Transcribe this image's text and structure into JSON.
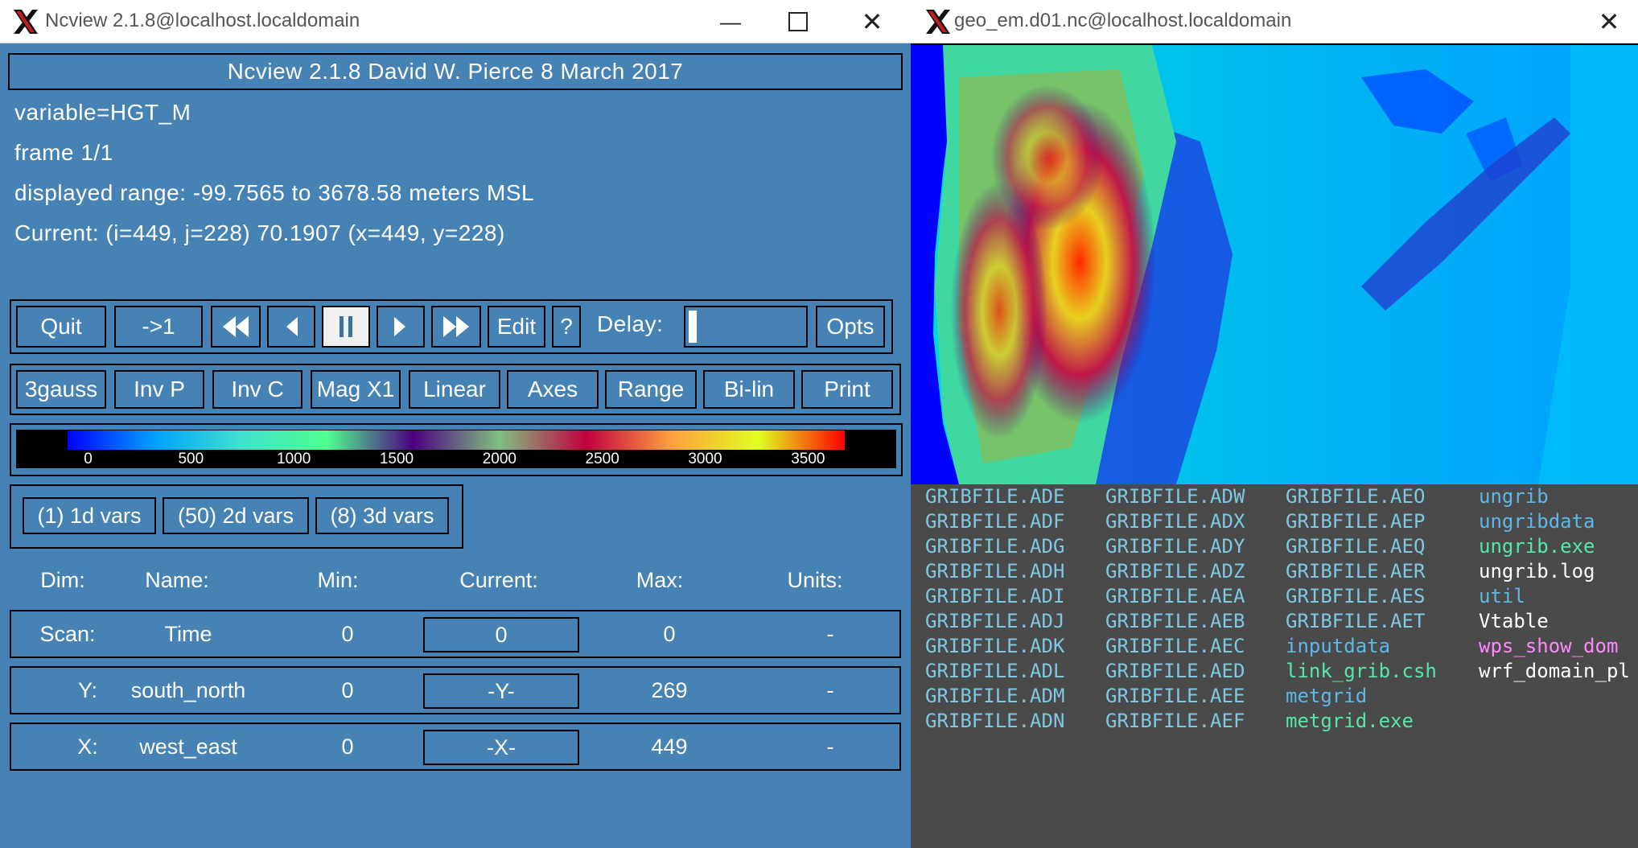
{
  "ncview": {
    "window_title": "Ncview 2.1.8@localhost.localdomain",
    "banner": "Ncview 2.1.8 David W. Pierce  8 March 2017",
    "info": {
      "variable": "variable=HGT_M",
      "frame": "frame 1/1",
      "range": "displayed range: -99.7565 to 3678.58 meters MSL",
      "current": "Current: (i=449, j=228) 70.1907 (x=449, y=228)"
    },
    "controls": {
      "quit": "Quit",
      "to_first": "->1",
      "edit": "Edit",
      "help": "?",
      "delay_label": "Delay:",
      "opts": "Opts"
    },
    "options": {
      "gauss": "3gauss",
      "inv_p": "Inv P",
      "inv_c": "Inv C",
      "mag": "Mag X1",
      "linear": "Linear",
      "axes": "Axes",
      "range": "Range",
      "bilin": "Bi-lin",
      "print": "Print"
    },
    "colorbar_ticks": [
      "0",
      "500",
      "1000",
      "1500",
      "2000",
      "2500",
      "3000",
      "3500"
    ],
    "var_groups": {
      "d1": "(1) 1d vars",
      "d2": "(50) 2d vars",
      "d3": "(8) 3d vars"
    },
    "dim_headers": {
      "dim": "Dim:",
      "name": "Name:",
      "min": "Min:",
      "current": "Current:",
      "max": "Max:",
      "units": "Units:"
    },
    "dims": [
      {
        "dim": "Scan:",
        "name": "Time",
        "min": "0",
        "current": "0",
        "max": "0",
        "units": "-"
      },
      {
        "dim": "Y:",
        "name": "south_north",
        "min": "0",
        "current": "-Y-",
        "max": "269",
        "units": "-"
      },
      {
        "dim": "X:",
        "name": "west_east",
        "min": "0",
        "current": "-X-",
        "max": "449",
        "units": "-"
      }
    ],
    "colors": {
      "panel_bg": "#4682b4",
      "colorbar": [
        "#000000",
        "#0000ff",
        "#00a0ff",
        "#40e0d0",
        "#50ff90",
        "#4b0082",
        "#80c080",
        "#c00040",
        "#ffa040",
        "#e0ff20",
        "#ff0000"
      ]
    }
  },
  "geo_window": {
    "window_title": "geo_em.d01.nc@localhost.localdomain"
  },
  "terminal": {
    "columns": [
      [
        "GRIBFILE.ADE",
        "GRIBFILE.ADF",
        "GRIBFILE.ADG",
        "GRIBFILE.ADH",
        "GRIBFILE.ADI",
        "GRIBFILE.ADJ",
        "GRIBFILE.ADK",
        "GRIBFILE.ADL",
        "GRIBFILE.ADM",
        "GRIBFILE.ADN"
      ],
      [
        "GRIBFILE.ADW",
        "GRIBFILE.ADX",
        "GRIBFILE.ADY",
        "GRIBFILE.ADZ",
        "GRIBFILE.AEA",
        "GRIBFILE.AEB",
        "GRIBFILE.AEC",
        "GRIBFILE.AED",
        "GRIBFILE.AEE",
        "GRIBFILE.AEF"
      ],
      [
        "GRIBFILE.AEO",
        "GRIBFILE.AEP",
        "GRIBFILE.AEQ",
        "GRIBFILE.AER",
        "GRIBFILE.AES",
        "GRIBFILE.AET",
        "inputdata",
        "link_grib.csh",
        "metgrid",
        "metgrid.exe"
      ],
      [
        "ungrib",
        "ungribdata",
        "ungrib.exe",
        "ungrib.log",
        "util",
        "Vtable",
        "wps_show_dom",
        "wrf_domain_pl"
      ]
    ],
    "colors": {
      "file": "#7ec8e3",
      "dir": "#5cb8e8",
      "exe": "#55e8a8",
      "plain": "#ffffff",
      "magenta": "#ff88ff"
    }
  }
}
